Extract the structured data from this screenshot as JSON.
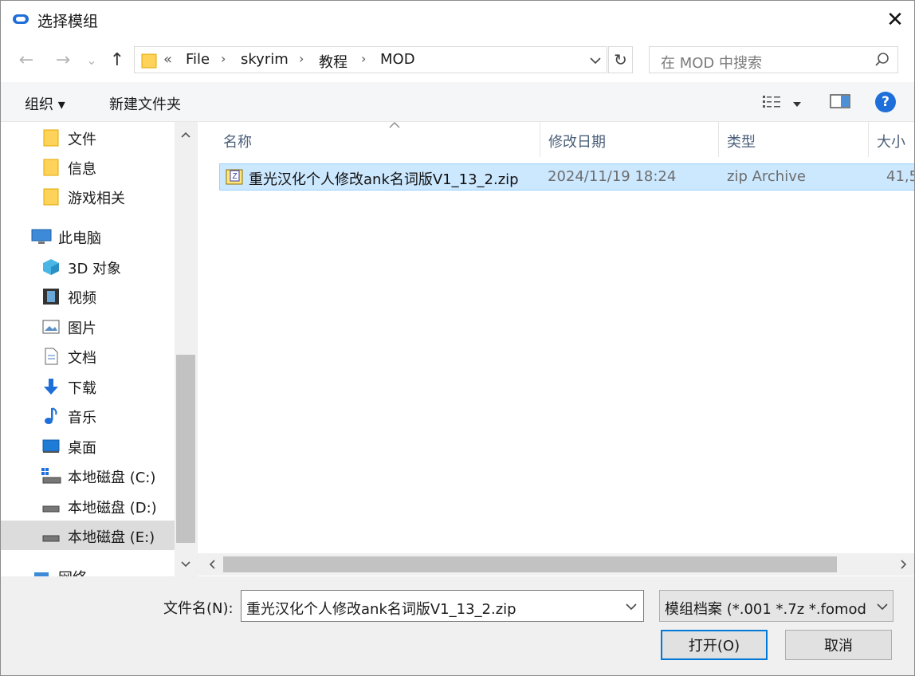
{
  "window": {
    "title": "选择模组",
    "close_symbol": "✕"
  },
  "nav": {
    "back_symbol": "←",
    "forward_symbol": "→",
    "recent_symbol": "⌄",
    "up_symbol": "↑",
    "crumb_overflow": "«",
    "breadcrumb": [
      "File",
      "skyrim",
      "教程",
      "MOD"
    ],
    "crumb_separator": "›",
    "refresh_symbol": "↻",
    "search_placeholder": "在 MOD 中搜索"
  },
  "commands": {
    "organize": "组织 ▾",
    "new_folder": "新建文件夹",
    "help_symbol": "?"
  },
  "sidebar": {
    "items": [
      {
        "label": "文件",
        "icon": "folder-icon"
      },
      {
        "label": "信息",
        "icon": "folder-icon"
      },
      {
        "label": "游戏相关",
        "icon": "folder-icon"
      },
      {
        "label": "此电脑",
        "icon": "computer-icon"
      },
      {
        "label": "3D 对象",
        "icon": "cube-icon"
      },
      {
        "label": "视频",
        "icon": "film-icon"
      },
      {
        "label": "图片",
        "icon": "picture-icon"
      },
      {
        "label": "文档",
        "icon": "document-icon"
      },
      {
        "label": "下载",
        "icon": "download-arrow-icon"
      },
      {
        "label": "音乐",
        "icon": "music-note-icon"
      },
      {
        "label": "桌面",
        "icon": "desktop-icon"
      },
      {
        "label": "本地磁盘 (C:)",
        "icon": "drive-c-icon"
      },
      {
        "label": "本地磁盘 (D:)",
        "icon": "drive-icon"
      },
      {
        "label": "本地磁盘 (E:)",
        "icon": "drive-icon"
      },
      {
        "label": "网络",
        "icon": "network-icon"
      }
    ],
    "selected_index": 13
  },
  "files": {
    "columns": [
      "名称",
      "修改日期",
      "类型",
      "大小"
    ],
    "rows": [
      {
        "name": "重光汉化个人修改ank名词版V1_13_2.zip",
        "modified": "2024/11/19 18:24",
        "type": "zip Archive",
        "size": "41,5"
      }
    ]
  },
  "footer": {
    "filename_label": "文件名(N):",
    "filename_value": "重光汉化个人修改ank名词版V1_13_2.zip",
    "filter_value": "模组档案 (*.001 *.7z *.fomod",
    "open_label": "打开(O)",
    "cancel_label": "取消"
  },
  "colors": {
    "selection": "#cce8ff",
    "accent": "#0078d7",
    "folder": "#ffd35a"
  }
}
